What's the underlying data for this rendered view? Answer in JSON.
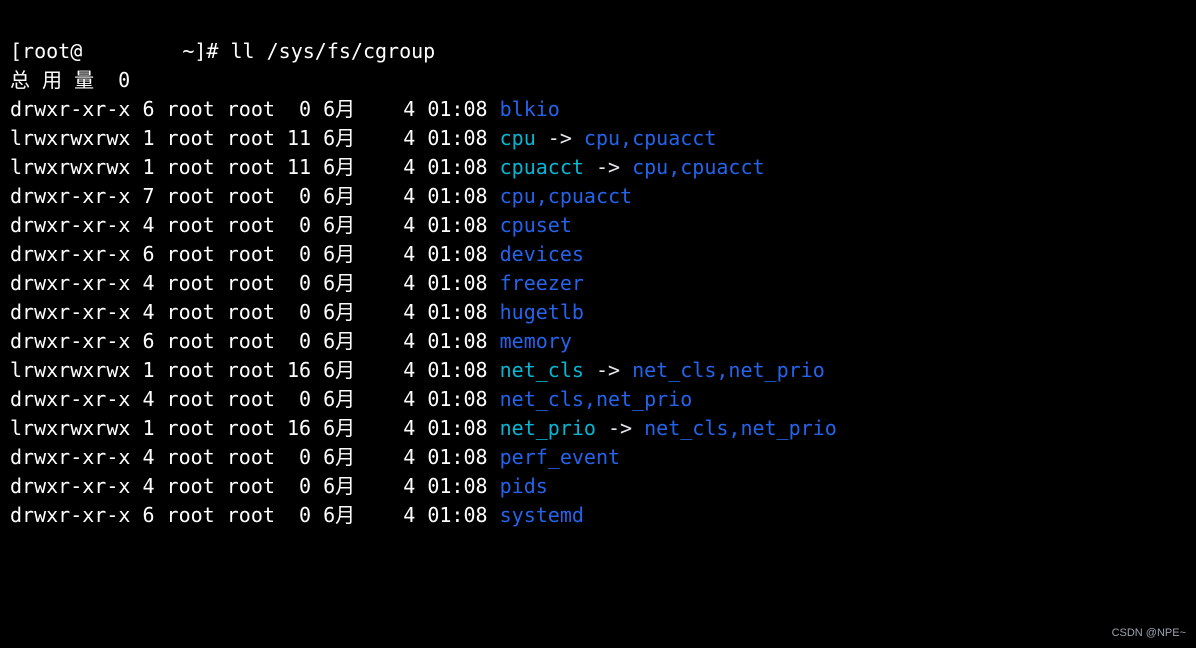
{
  "prompt": {
    "user": "root",
    "at": "@",
    "host_hidden": true,
    "path": "~",
    "suffix": "]#",
    "command": "ll /sys/fs/cgroup"
  },
  "total_line": "总 用 量  0",
  "entries": [
    {
      "perms": "drwxr-xr-x",
      "links": "6",
      "owner": "root",
      "group": "root",
      "size": "0",
      "month": "6月",
      "day": "4",
      "time": "01:08",
      "name": "blkio",
      "type": "dir"
    },
    {
      "perms": "lrwxrwxrwx",
      "links": "1",
      "owner": "root",
      "group": "root",
      "size": "11",
      "month": "6月",
      "day": "4",
      "time": "01:08",
      "name": "cpu",
      "type": "link",
      "target": "cpu,cpuacct"
    },
    {
      "perms": "lrwxrwxrwx",
      "links": "1",
      "owner": "root",
      "group": "root",
      "size": "11",
      "month": "6月",
      "day": "4",
      "time": "01:08",
      "name": "cpuacct",
      "type": "link",
      "target": "cpu,cpuacct"
    },
    {
      "perms": "drwxr-xr-x",
      "links": "7",
      "owner": "root",
      "group": "root",
      "size": "0",
      "month": "6月",
      "day": "4",
      "time": "01:08",
      "name": "cpu,cpuacct",
      "type": "dir"
    },
    {
      "perms": "drwxr-xr-x",
      "links": "4",
      "owner": "root",
      "group": "root",
      "size": "0",
      "month": "6月",
      "day": "4",
      "time": "01:08",
      "name": "cpuset",
      "type": "dir"
    },
    {
      "perms": "drwxr-xr-x",
      "links": "6",
      "owner": "root",
      "group": "root",
      "size": "0",
      "month": "6月",
      "day": "4",
      "time": "01:08",
      "name": "devices",
      "type": "dir"
    },
    {
      "perms": "drwxr-xr-x",
      "links": "4",
      "owner": "root",
      "group": "root",
      "size": "0",
      "month": "6月",
      "day": "4",
      "time": "01:08",
      "name": "freezer",
      "type": "dir"
    },
    {
      "perms": "drwxr-xr-x",
      "links": "4",
      "owner": "root",
      "group": "root",
      "size": "0",
      "month": "6月",
      "day": "4",
      "time": "01:08",
      "name": "hugetlb",
      "type": "dir"
    },
    {
      "perms": "drwxr-xr-x",
      "links": "6",
      "owner": "root",
      "group": "root",
      "size": "0",
      "month": "6月",
      "day": "4",
      "time": "01:08",
      "name": "memory",
      "type": "dir"
    },
    {
      "perms": "lrwxrwxrwx",
      "links": "1",
      "owner": "root",
      "group": "root",
      "size": "16",
      "month": "6月",
      "day": "4",
      "time": "01:08",
      "name": "net_cls",
      "type": "link",
      "target": "net_cls,net_prio"
    },
    {
      "perms": "drwxr-xr-x",
      "links": "4",
      "owner": "root",
      "group": "root",
      "size": "0",
      "month": "6月",
      "day": "4",
      "time": "01:08",
      "name": "net_cls,net_prio",
      "type": "dir"
    },
    {
      "perms": "lrwxrwxrwx",
      "links": "1",
      "owner": "root",
      "group": "root",
      "size": "16",
      "month": "6月",
      "day": "4",
      "time": "01:08",
      "name": "net_prio",
      "type": "link",
      "target": "net_cls,net_prio"
    },
    {
      "perms": "drwxr-xr-x",
      "links": "4",
      "owner": "root",
      "group": "root",
      "size": "0",
      "month": "6月",
      "day": "4",
      "time": "01:08",
      "name": "perf_event",
      "type": "dir"
    },
    {
      "perms": "drwxr-xr-x",
      "links": "4",
      "owner": "root",
      "group": "root",
      "size": "0",
      "month": "6月",
      "day": "4",
      "time": "01:08",
      "name": "pids",
      "type": "dir"
    },
    {
      "perms": "drwxr-xr-x",
      "links": "6",
      "owner": "root",
      "group": "root",
      "size": "0",
      "month": "6月",
      "day": "4",
      "time": "01:08",
      "name": "systemd",
      "type": "dir"
    }
  ],
  "watermark": "CSDN @NPE~"
}
